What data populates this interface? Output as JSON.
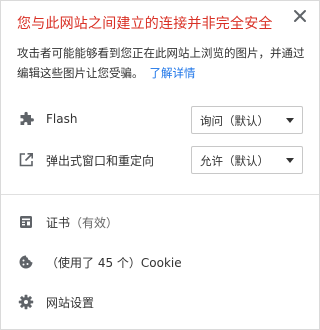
{
  "header": {
    "title": "您与此网站之间建立的连接并非完全安全",
    "close_label": "关闭"
  },
  "description": {
    "text": "攻击者可能能够看到您正在此网站上浏览的图片，并通过编辑这些图片让您受骗。",
    "link": "了解详情"
  },
  "permissions": [
    {
      "icon": "puzzle-icon",
      "label": "Flash",
      "value": "询问（默认）"
    },
    {
      "icon": "external-link-icon",
      "label": "弹出式窗口和重定向",
      "value": "允许（默认）"
    }
  ],
  "items": {
    "certificate": {
      "icon": "certificate-icon",
      "label": "证书",
      "status": "（有效）"
    },
    "cookie": {
      "icon": "cookie-icon",
      "label": "（使用了 45 个）Cookie"
    },
    "site_settings": {
      "icon": "gear-icon",
      "label": "网站设置"
    }
  },
  "colors": {
    "warning": "#d93025",
    "link": "#1a73e8",
    "text": "#333333",
    "icon": "#5f6368"
  }
}
